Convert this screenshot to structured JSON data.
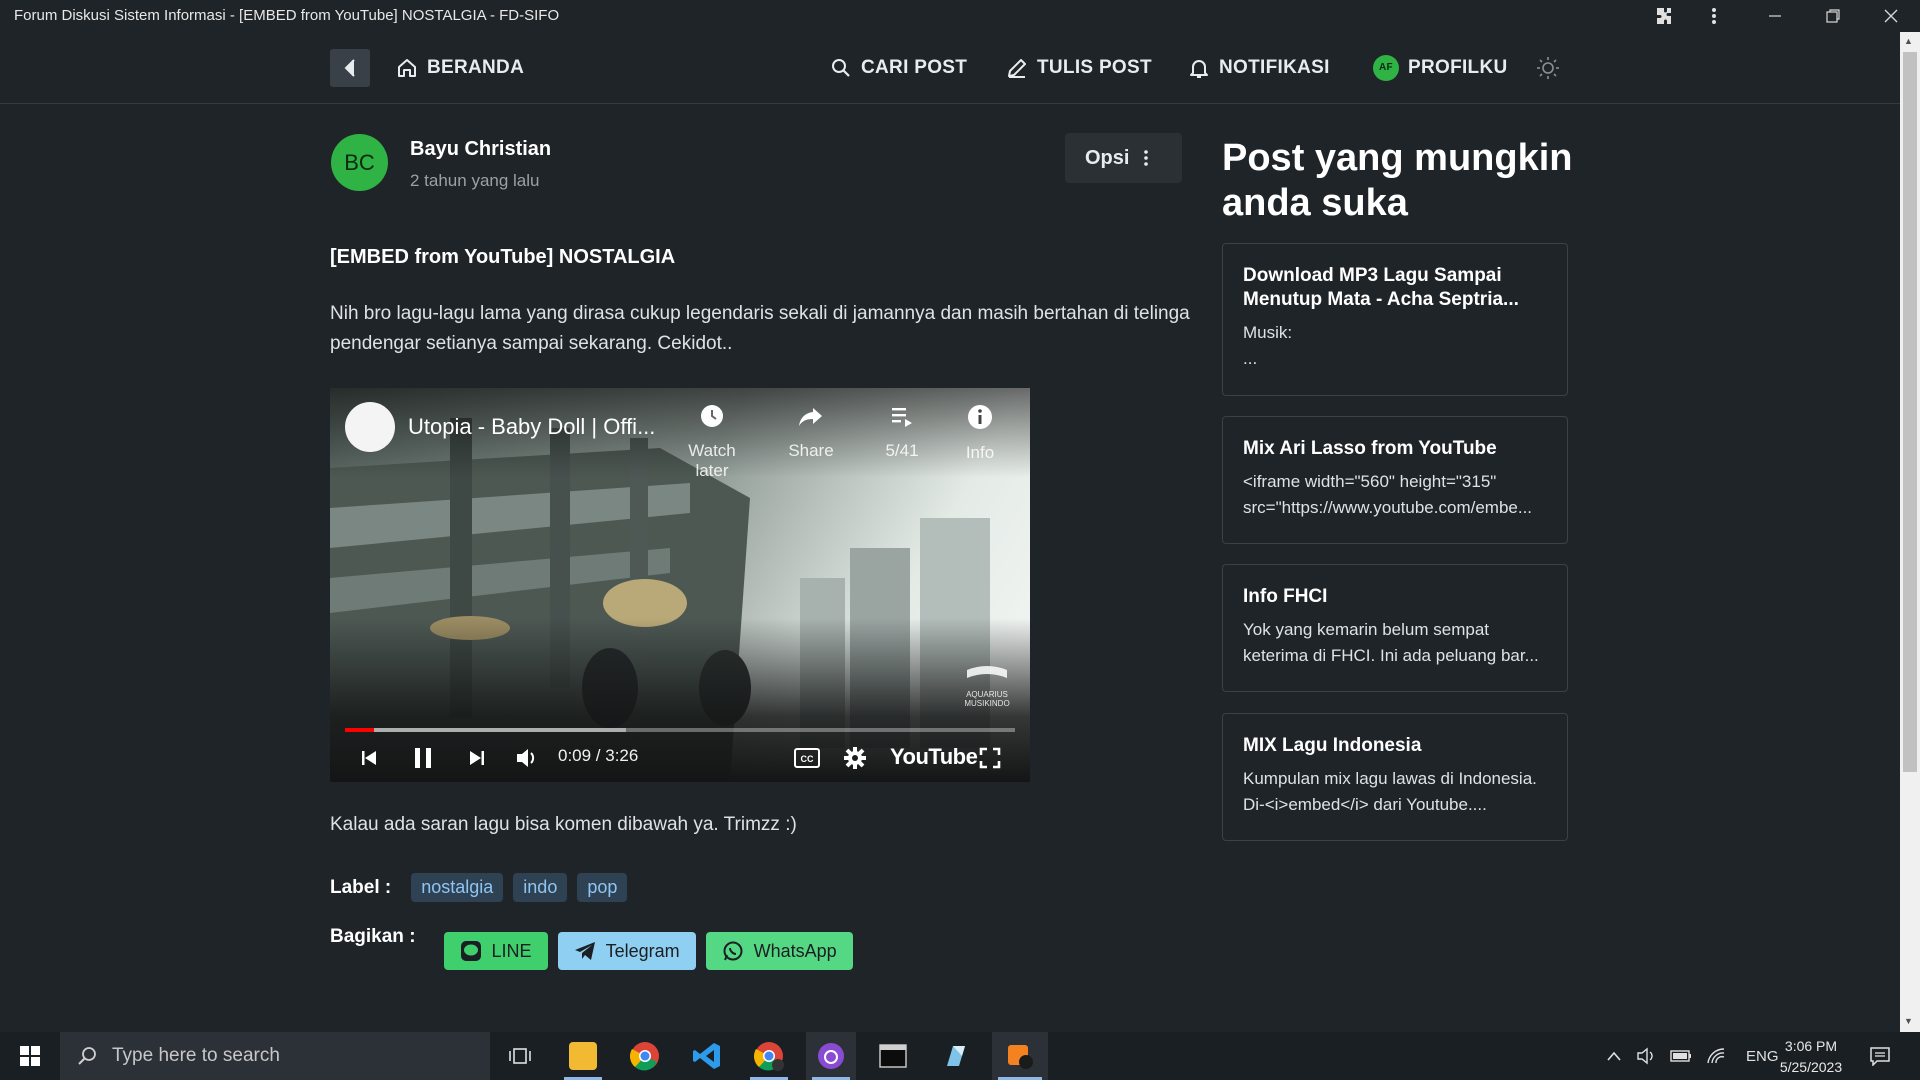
{
  "window": {
    "title": "Forum Diskusi Sistem Informasi - [EMBED from YouTube] NOSTALGIA - FD-SIFO"
  },
  "nav": {
    "home": "BERANDA",
    "search": "CARI POST",
    "write": "TULIS POST",
    "notifications": "NOTIFIKASI",
    "profile_initials": "AF",
    "profile": "PROFILKU"
  },
  "post": {
    "author_initials": "BC",
    "author": "Bayu Christian",
    "time": "2 tahun yang lalu",
    "options_label": "Opsi",
    "title": "[EMBED from YouTube] NOSTALGIA",
    "body": "Nih bro lagu-lagu lama yang dirasa cukup legendaris sekali di jamannya dan masih bertahan di telinga pendengar setianya sampai sekarang. Cekidot..",
    "after_video": "Kalau ada saran lagu bisa komen dibawah ya. Trimzz :)",
    "label_title": "Label :",
    "tags": [
      "nostalgia",
      "indo",
      "pop"
    ],
    "share_title": "Bagikan :",
    "share": [
      "LINE",
      "Telegram",
      "WhatsApp"
    ]
  },
  "video": {
    "title": "Utopia - Baby Doll | Offi...",
    "actions": [
      "Watch later",
      "Share",
      "5/41",
      "Info"
    ],
    "time": "0:09 / 3:26",
    "played_fraction": 0.044,
    "buffered_fraction": 0.42,
    "logo": "YouTube",
    "watermark": "AQUARIUS MUSIKINDO"
  },
  "sidebar": {
    "title": "Post yang mungkin anda suka",
    "cards": [
      {
        "title": "Download MP3 Lagu Sampai Menutup Mata - Acha Septria...",
        "line1": "Musik:",
        "line2": "..."
      },
      {
        "title": "Mix Ari Lasso from YouTube",
        "line1": "<iframe width=\"560\" height=\"315\"",
        "line2": "src=\"https://www.youtube.com/embe..."
      },
      {
        "title": "Info FHCI",
        "line1": "Yok yang kemarin belum sempat",
        "line2": "keterima di FHCI. Ini ada peluang bar..."
      },
      {
        "title": "MIX Lagu Indonesia",
        "line1": "Kumpulan mix lagu lawas di Indonesia.",
        "line2": "Di-<i>embed</i> dari Youtube...."
      }
    ]
  },
  "taskbar": {
    "search_placeholder": "Type here to search",
    "lang": "ENG",
    "time": "3:06 PM",
    "date": "5/25/2023"
  },
  "colors": {
    "background": "#1f2428",
    "avatar_green": "#2fb344",
    "tag_bg": "#2f4254",
    "tag_text": "#8ec5f3",
    "line_green": "#3fcf6d",
    "telegram_blue": "#8fd0f2",
    "whatsapp_green": "#55d884"
  }
}
